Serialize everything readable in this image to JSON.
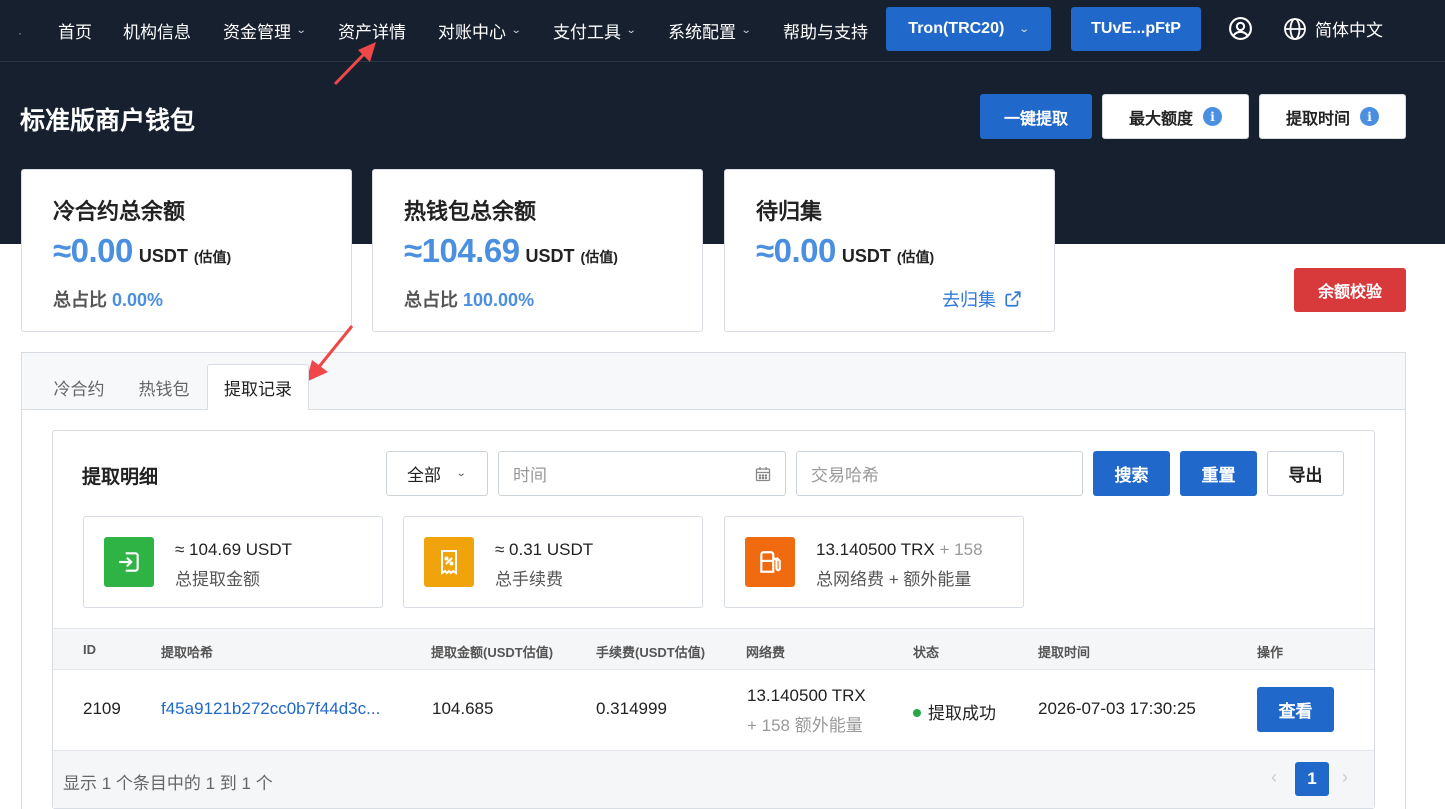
{
  "nav": {
    "items": [
      {
        "label": "首页",
        "dropdown": false
      },
      {
        "label": "机构信息",
        "dropdown": false
      },
      {
        "label": "资金管理",
        "dropdown": true
      },
      {
        "label": "资产详情",
        "dropdown": false
      },
      {
        "label": "对账中心",
        "dropdown": true
      },
      {
        "label": "支付工具",
        "dropdown": true
      },
      {
        "label": "系统配置",
        "dropdown": true
      },
      {
        "label": "帮助与支持",
        "dropdown": false
      }
    ],
    "network": "Tron(TRC20)",
    "address": "TUvE...pFtP",
    "language": "简体中文"
  },
  "header": {
    "title": "标准版商户钱包",
    "buttons": {
      "withdraw_all": "一键提取",
      "max_limit": "最大额度",
      "withdraw_time": "提取时间"
    }
  },
  "cards": [
    {
      "title": "冷合约总余额",
      "amount": "≈0.00",
      "unit": "USDT",
      "estimate": "(估值)",
      "ratio_label": "总占比",
      "ratio": "0.00%"
    },
    {
      "title": "热钱包总余额",
      "amount": "≈104.69",
      "unit": "USDT",
      "estimate": "(估值)",
      "ratio_label": "总占比",
      "ratio": "100.00%"
    },
    {
      "title": "待归集",
      "amount": "≈0.00",
      "unit": "USDT",
      "estimate": "(估值)",
      "link": "去归集"
    }
  ],
  "balance_check": "余额校验",
  "tabs": [
    "冷合约",
    "热钱包",
    "提取记录"
  ],
  "active_tab": "提取记录",
  "withdraw": {
    "title": "提取明细",
    "filter": {
      "type_selected": "全部",
      "time_placeholder": "时间",
      "hash_placeholder": "交易哈希"
    },
    "buttons": {
      "search": "搜索",
      "reset": "重置",
      "export": "导出"
    },
    "stats": [
      {
        "value": "≈ 104.69 USDT",
        "extra": "",
        "label": "总提取金额",
        "icon": "withdraw-icon",
        "color": "#2fb344"
      },
      {
        "value": "≈ 0.31 USDT",
        "extra": "",
        "label": "总手续费",
        "icon": "receipt-icon",
        "color": "#f0a30a"
      },
      {
        "value": "13.140500 TRX",
        "extra": "+ 158",
        "label": "总网络费 + 额外能量",
        "icon": "fuel-icon",
        "color": "#f06a0f"
      }
    ],
    "table": {
      "headers": [
        "ID",
        "提取哈希",
        "提取金额(USDT估值)",
        "手续费(USDT估值)",
        "网络费",
        "状态",
        "提取时间",
        "操作"
      ],
      "rows": [
        {
          "id": "2109",
          "hash": "f45a9121b272cc0b7f44d3c...",
          "amount": "104.685",
          "fee": "0.314999",
          "network_fee": "13.140500 TRX",
          "network_extra": "+ 158 额外能量",
          "status": "提取成功",
          "time": "2026-07-03 17:30:25",
          "action": "查看"
        }
      ]
    },
    "footer": {
      "summary": "显示 1 个条目中的 1 到 1 个",
      "page": "1"
    }
  }
}
